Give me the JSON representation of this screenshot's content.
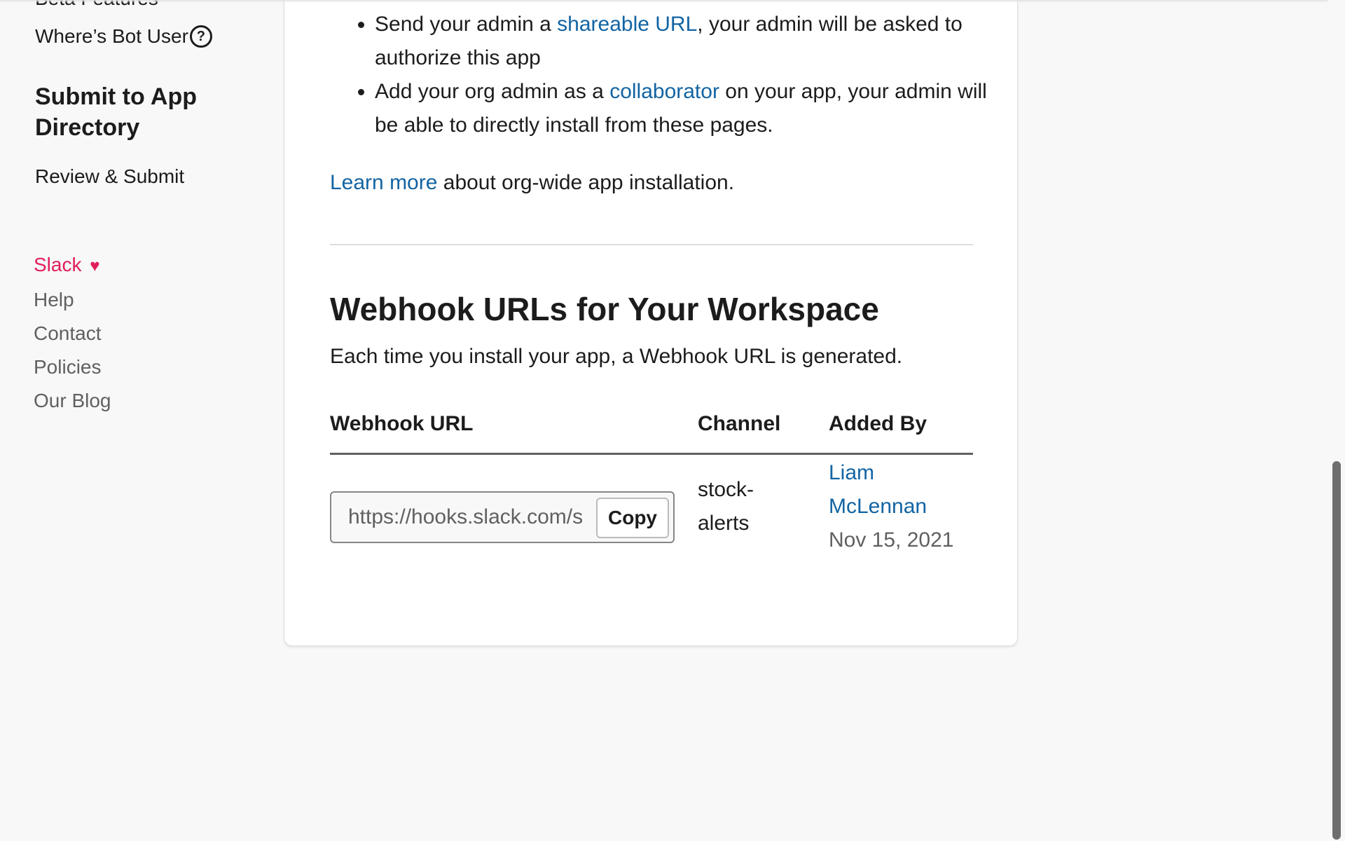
{
  "sidebar": {
    "beta_features": "Beta Features",
    "bot_user": "Where’s Bot User",
    "bot_user_help_icon": "?",
    "submit_heading": "Submit to App Directory",
    "review_submit": "Review & Submit",
    "footer_links": [
      {
        "label": "Slack",
        "icon": "heart-icon",
        "glyph": "♥"
      },
      {
        "label": "Help"
      },
      {
        "label": "Contact"
      },
      {
        "label": "Policies"
      },
      {
        "label": "Our Blog"
      }
    ]
  },
  "main": {
    "bullets": [
      {
        "before": "Send your admin a ",
        "link": "shareable URL",
        "after": ", your admin will be asked to authorize this app"
      },
      {
        "before": "Add your org admin as a ",
        "link": "collaborator",
        "after": " on your app, your admin will be able to directly install from these pages."
      }
    ],
    "learn_more": {
      "link": "Learn more",
      "after": " about org-wide app installation."
    },
    "section_title": "Webhook URLs for Your Workspace",
    "section_subtitle": "Each time you install your app, a Webhook URL is generated.",
    "table": {
      "headers": [
        "Webhook URL",
        "Channel",
        "Added By"
      ],
      "rows": [
        {
          "webhook_url": "https://hooks.slack.com/s",
          "copy_label": "Copy",
          "channel": "stock-alerts",
          "added_by": "Liam McLennan",
          "date": "Nov 15, 2021"
        }
      ]
    }
  },
  "colors": {
    "link": "#1264a3",
    "slack_brand": "#e01e5a",
    "text": "#1d1c1d",
    "muted": "#616061",
    "background": "#f8f8f8"
  }
}
